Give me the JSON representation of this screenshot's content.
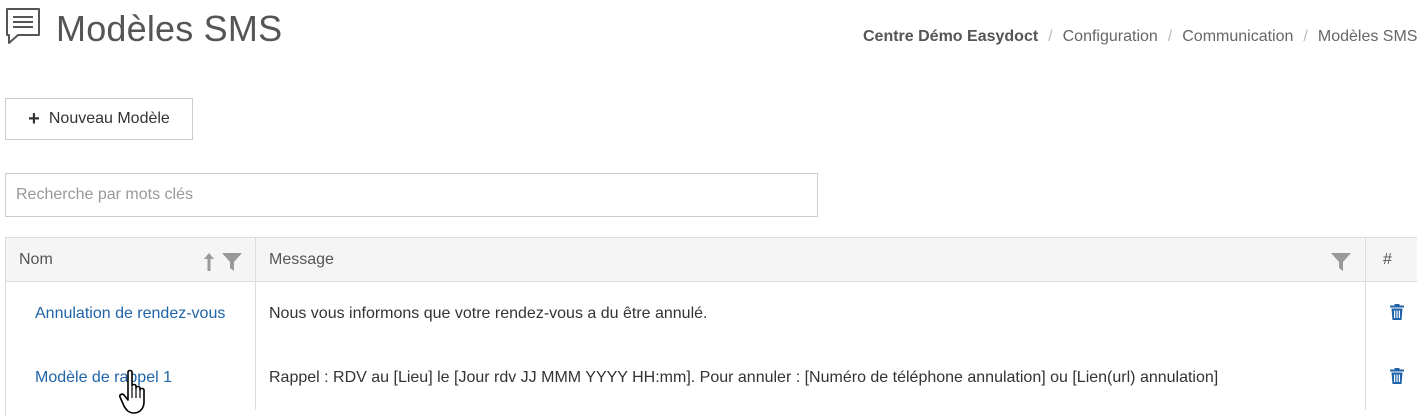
{
  "header": {
    "title": "Modèles SMS",
    "icon": "sms-template-icon",
    "breadcrumb": [
      "Centre Démo Easydoct",
      "Configuration",
      "Communication",
      "Modèles SMS"
    ]
  },
  "toolbar": {
    "new_button_label": "Nouveau Modèle",
    "new_button_icon": "plus-icon"
  },
  "search": {
    "placeholder": "Recherche par mots clés",
    "value": ""
  },
  "table": {
    "columns": [
      {
        "label": "Nom",
        "icons": [
          "sort-up-icon",
          "filter-icon"
        ]
      },
      {
        "label": "Message",
        "icons": [
          "filter-icon"
        ]
      },
      {
        "label": "#",
        "icons": []
      }
    ],
    "rows": [
      {
        "name": "Annulation de rendez-vous",
        "message": "Nous vous informons que votre rendez-vous a du être annulé.",
        "action_icon": "trash-icon"
      },
      {
        "name": "Modèle de rappel 1",
        "message": "Rappel : RDV au [Lieu] le [Jour rdv JJ MMM YYYY HH:mm]. Pour annuler : [Numéro de téléphone annulation] ou [Lien(url) annulation]",
        "action_icon": "trash-icon"
      }
    ]
  },
  "colors": {
    "link": "#1f63a8",
    "header_bg": "#f5f5f5",
    "border": "#dddddd",
    "title": "#555555"
  }
}
